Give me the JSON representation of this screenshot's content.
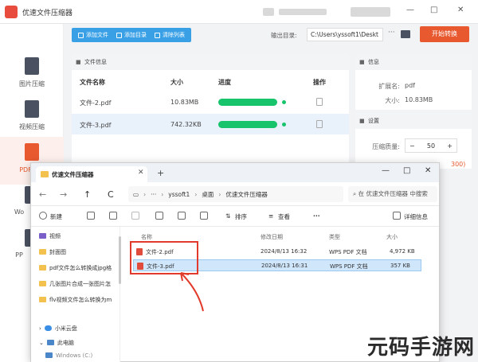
{
  "app": {
    "title": "优速文件压缩器",
    "window_controls": [
      "—",
      "□",
      "✕"
    ]
  },
  "sidebar": {
    "items": [
      {
        "label": "图片压缩",
        "icon": "image-file-icon"
      },
      {
        "label": "视频压缩",
        "icon": "video-file-icon"
      },
      {
        "label": "PDF压缩",
        "icon": "pdf-file-icon",
        "active": true
      },
      {
        "label": "Wo",
        "icon": "word-file-icon"
      },
      {
        "label": "PP",
        "icon": "ppt-file-icon"
      }
    ]
  },
  "toolbar": {
    "add_file": "添加文件",
    "add_dir": "添加目录",
    "clear_list": "清除列表",
    "output_label": "输出目录:",
    "output_path": "C:\\Users\\yssoft1\\Deskt",
    "start": "开始转换"
  },
  "file_panel": {
    "header": "文件信息",
    "columns": [
      "文件名称",
      "大小",
      "进度",
      "操作"
    ],
    "rows": [
      {
        "name": "文件-2.pdf",
        "size": "10.83MB",
        "progress": 1.0
      },
      {
        "name": "文件-3.pdf",
        "size": "742.32KB",
        "progress": 1.0
      }
    ]
  },
  "info_panel": {
    "header": "信息",
    "ext_label": "扩展名:",
    "ext_value": "pdf",
    "size_label": "大小:",
    "size_value": "10.83MB"
  },
  "settings_panel": {
    "header": "设置",
    "quality_label": "压缩质量:",
    "quality_minus": "−",
    "quality_value": "50",
    "quality_plus": "+",
    "hint": "300)"
  },
  "explorer": {
    "tab_title": "优速文件压缩器",
    "tab_close": "✕",
    "new_tab": "+",
    "controls": [
      "—",
      "□",
      "✕"
    ],
    "nav": {
      "back": "←",
      "forward": "→",
      "up": "↑",
      "refresh": "C"
    },
    "breadcrumb": [
      "yssoft1",
      "桌面",
      "优速文件压缩器"
    ],
    "breadcrumb_more": "···",
    "search_placeholder": "在 优速文件压缩器 中搜索",
    "commands": {
      "new": "新建",
      "sort": "排序",
      "view": "查看",
      "more": "···",
      "details": "详细信息"
    },
    "sidebar": [
      {
        "label": "视频",
        "kind": "video"
      },
      {
        "label": "封面图",
        "kind": "folder"
      },
      {
        "label": "pdf文件怎么转换成jpg格",
        "kind": "folder"
      },
      {
        "label": "几张图片合成一张图片怎",
        "kind": "folder"
      },
      {
        "label": "flv视频文件怎么转换为m",
        "kind": "folder"
      },
      {
        "label": "小米云盘",
        "kind": "cloud"
      },
      {
        "label": "此电脑",
        "kind": "pc"
      },
      {
        "label": "Windows (C:)",
        "kind": "pc"
      }
    ],
    "list_columns": [
      "名称",
      "修改日期",
      "类型",
      "大小"
    ],
    "files": [
      {
        "name": "文件-2.pdf",
        "modified": "2024/8/13 16:32",
        "type": "WPS PDF 文档",
        "size": "4,972 KB",
        "selected": false
      },
      {
        "name": "文件-3.pdf",
        "modified": "2024/8/13 16:31",
        "type": "WPS PDF 文档",
        "size": "357 KB",
        "selected": true
      }
    ]
  },
  "watermark": "元码手游网",
  "colors": {
    "accent_blue": "#3aa0e6",
    "start_orange": "#e8592f",
    "progress_green": "#17c36b",
    "highlight_red": "#e23a2a"
  }
}
